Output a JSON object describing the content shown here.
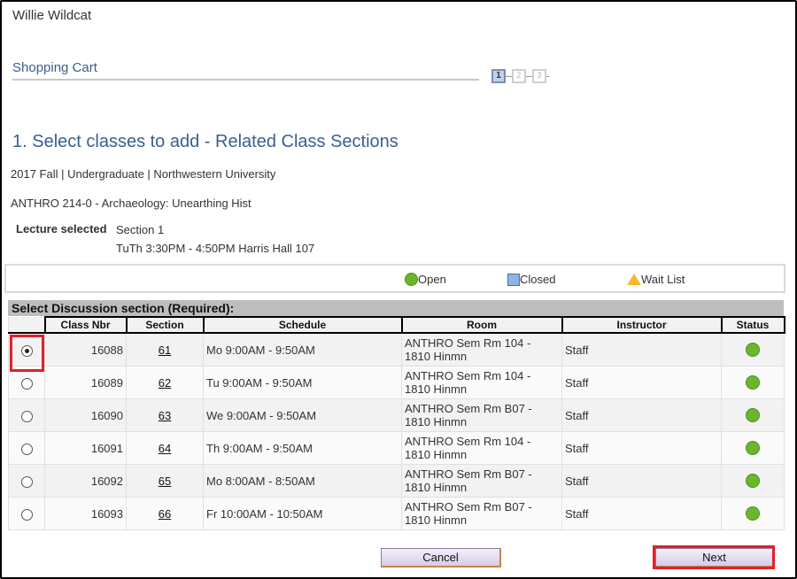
{
  "header": {
    "user_name": "Willie Wildcat",
    "cart_title": "Shopping Cart",
    "steps": [
      {
        "label": "1",
        "active": true
      },
      {
        "label": "2",
        "active": false
      },
      {
        "label": "3",
        "active": false
      }
    ]
  },
  "page": {
    "heading": "1.  Select classes to add - Related Class Sections",
    "term_line": "2017 Fall | Undergraduate | Northwestern University",
    "course_line": "ANTHRO  214-0 - Archaeology: Unearthing Hist",
    "lecture": {
      "label": "Lecture selected",
      "section": "Section 1",
      "schedule": "TuTh 3:30PM - 4:50PM   Harris Hall 107"
    }
  },
  "legend": {
    "open": "Open",
    "closed": "Closed",
    "wait_list": "Wait List"
  },
  "grid": {
    "title": "Select Discussion section (Required):",
    "columns": [
      "",
      "Class Nbr",
      "Section",
      "Schedule",
      "Room",
      "Instructor",
      "Status"
    ],
    "selected_index": 0,
    "rows": [
      {
        "class_nbr": "16088",
        "section": "61",
        "schedule": "Mo 9:00AM - 9:50AM",
        "room_line1": "ANTHRO Sem Rm 104 -",
        "room_line2": "1810 Hinmn",
        "instructor": "Staff",
        "status": "Open"
      },
      {
        "class_nbr": "16089",
        "section": "62",
        "schedule": "Tu 9:00AM - 9:50AM",
        "room_line1": "ANTHRO Sem Rm 104 -",
        "room_line2": "1810 Hinmn",
        "instructor": "Staff",
        "status": "Open"
      },
      {
        "class_nbr": "16090",
        "section": "63",
        "schedule": "We 9:00AM - 9:50AM",
        "room_line1": "ANTHRO Sem Rm B07 -",
        "room_line2": "1810 Hinmn",
        "instructor": "Staff",
        "status": "Open"
      },
      {
        "class_nbr": "16091",
        "section": "64",
        "schedule": "Th 9:00AM - 9:50AM",
        "room_line1": "ANTHRO Sem Rm 104 -",
        "room_line2": "1810 Hinmn",
        "instructor": "Staff",
        "status": "Open"
      },
      {
        "class_nbr": "16092",
        "section": "65",
        "schedule": "Mo 8:00AM - 8:50AM",
        "room_line1": "ANTHRO Sem Rm B07 -",
        "room_line2": "1810 Hinmn",
        "instructor": "Staff",
        "status": "Open"
      },
      {
        "class_nbr": "16093",
        "section": "66",
        "schedule": "Fr 10:00AM - 10:50AM",
        "room_line1": "ANTHRO Sem Rm B07 -",
        "room_line2": "1810 Hinmn",
        "instructor": "Staff",
        "status": "Open"
      }
    ]
  },
  "buttons": {
    "cancel": "Cancel",
    "next": "Next"
  },
  "colors": {
    "heading_blue": "#3a5f8f",
    "status_open": "#6cb52d",
    "status_closed": "#8fb4e3",
    "status_wait": "#f5b82e",
    "highlight_red": "#e0202a"
  }
}
